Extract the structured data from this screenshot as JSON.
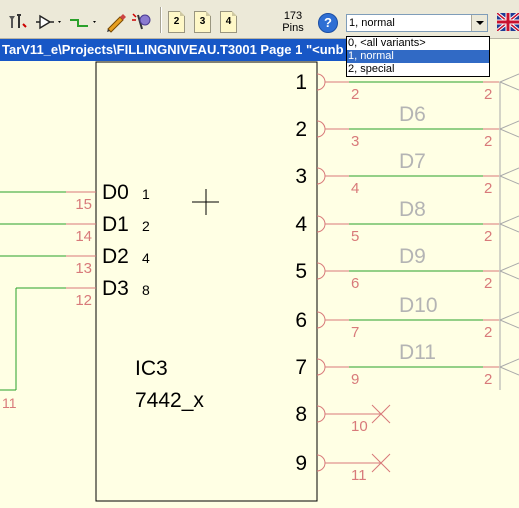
{
  "toolbar": {
    "pins_count": "173",
    "pins_label": "Pins",
    "page_buttons": [
      "2",
      "3",
      "4"
    ],
    "help_symbol": "?",
    "variant_selected": "1, normal"
  },
  "variant_options": [
    "0, <all variants>",
    "1, normal",
    "2, special"
  ],
  "selected_variant_index": 1,
  "title": "TarV11_e\\Projects\\FILLINGNIVEAU.T3001 Page 1 \"<unb",
  "ic": {
    "name": "IC3",
    "part": "7442_x",
    "left_pins": [
      {
        "name": "D0",
        "num": "1",
        "net": "15"
      },
      {
        "name": "D1",
        "num": "2",
        "net": "14"
      },
      {
        "name": "D2",
        "num": "4",
        "net": "13"
      },
      {
        "name": "D3",
        "num": "8",
        "net": "12"
      }
    ],
    "right_pins": [
      {
        "num": "1",
        "net": "2",
        "net_right": "2",
        "label": ""
      },
      {
        "num": "2",
        "net": "3",
        "net_right": "2",
        "label": "D6"
      },
      {
        "num": "3",
        "net": "4",
        "net_right": "2",
        "label": "D7"
      },
      {
        "num": "4",
        "net": "5",
        "net_right": "2",
        "label": "D8"
      },
      {
        "num": "5",
        "net": "6",
        "net_right": "2",
        "label": "D9"
      },
      {
        "num": "6",
        "net": "7",
        "net_right": "2",
        "label": "D10"
      },
      {
        "num": "7",
        "net": "9",
        "net_right": "2",
        "label": "D11"
      },
      {
        "num": "8",
        "net": "10",
        "net_right": "",
        "label": ""
      },
      {
        "num": "9",
        "net": "11",
        "net_right": "",
        "label": ""
      }
    ]
  },
  "wire_label": "11",
  "colors": {
    "background": "#ffffe4",
    "wire": "#2aa02a",
    "pin_red": "#d87a7a",
    "body": "#000000",
    "faded_label": "#b4b4b4",
    "title_bar": "#1757c6",
    "toolbar": "#ece9d8"
  }
}
